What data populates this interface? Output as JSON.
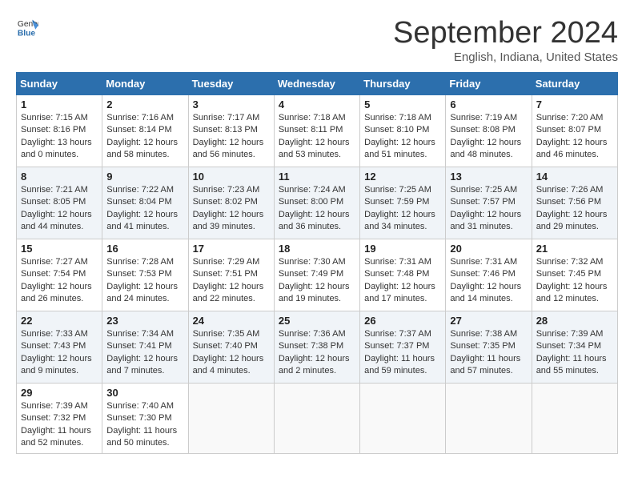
{
  "header": {
    "logo_general": "General",
    "logo_blue": "Blue",
    "month_title": "September 2024",
    "subtitle": "English, Indiana, United States"
  },
  "weekdays": [
    "Sunday",
    "Monday",
    "Tuesday",
    "Wednesday",
    "Thursday",
    "Friday",
    "Saturday"
  ],
  "weeks": [
    [
      {
        "day": "1",
        "info": "Sunrise: 7:15 AM\nSunset: 8:16 PM\nDaylight: 13 hours\nand 0 minutes."
      },
      {
        "day": "2",
        "info": "Sunrise: 7:16 AM\nSunset: 8:14 PM\nDaylight: 12 hours\nand 58 minutes."
      },
      {
        "day": "3",
        "info": "Sunrise: 7:17 AM\nSunset: 8:13 PM\nDaylight: 12 hours\nand 56 minutes."
      },
      {
        "day": "4",
        "info": "Sunrise: 7:18 AM\nSunset: 8:11 PM\nDaylight: 12 hours\nand 53 minutes."
      },
      {
        "day": "5",
        "info": "Sunrise: 7:18 AM\nSunset: 8:10 PM\nDaylight: 12 hours\nand 51 minutes."
      },
      {
        "day": "6",
        "info": "Sunrise: 7:19 AM\nSunset: 8:08 PM\nDaylight: 12 hours\nand 48 minutes."
      },
      {
        "day": "7",
        "info": "Sunrise: 7:20 AM\nSunset: 8:07 PM\nDaylight: 12 hours\nand 46 minutes."
      }
    ],
    [
      {
        "day": "8",
        "info": "Sunrise: 7:21 AM\nSunset: 8:05 PM\nDaylight: 12 hours\nand 44 minutes."
      },
      {
        "day": "9",
        "info": "Sunrise: 7:22 AM\nSunset: 8:04 PM\nDaylight: 12 hours\nand 41 minutes."
      },
      {
        "day": "10",
        "info": "Sunrise: 7:23 AM\nSunset: 8:02 PM\nDaylight: 12 hours\nand 39 minutes."
      },
      {
        "day": "11",
        "info": "Sunrise: 7:24 AM\nSunset: 8:00 PM\nDaylight: 12 hours\nand 36 minutes."
      },
      {
        "day": "12",
        "info": "Sunrise: 7:25 AM\nSunset: 7:59 PM\nDaylight: 12 hours\nand 34 minutes."
      },
      {
        "day": "13",
        "info": "Sunrise: 7:25 AM\nSunset: 7:57 PM\nDaylight: 12 hours\nand 31 minutes."
      },
      {
        "day": "14",
        "info": "Sunrise: 7:26 AM\nSunset: 7:56 PM\nDaylight: 12 hours\nand 29 minutes."
      }
    ],
    [
      {
        "day": "15",
        "info": "Sunrise: 7:27 AM\nSunset: 7:54 PM\nDaylight: 12 hours\nand 26 minutes."
      },
      {
        "day": "16",
        "info": "Sunrise: 7:28 AM\nSunset: 7:53 PM\nDaylight: 12 hours\nand 24 minutes."
      },
      {
        "day": "17",
        "info": "Sunrise: 7:29 AM\nSunset: 7:51 PM\nDaylight: 12 hours\nand 22 minutes."
      },
      {
        "day": "18",
        "info": "Sunrise: 7:30 AM\nSunset: 7:49 PM\nDaylight: 12 hours\nand 19 minutes."
      },
      {
        "day": "19",
        "info": "Sunrise: 7:31 AM\nSunset: 7:48 PM\nDaylight: 12 hours\nand 17 minutes."
      },
      {
        "day": "20",
        "info": "Sunrise: 7:31 AM\nSunset: 7:46 PM\nDaylight: 12 hours\nand 14 minutes."
      },
      {
        "day": "21",
        "info": "Sunrise: 7:32 AM\nSunset: 7:45 PM\nDaylight: 12 hours\nand 12 minutes."
      }
    ],
    [
      {
        "day": "22",
        "info": "Sunrise: 7:33 AM\nSunset: 7:43 PM\nDaylight: 12 hours\nand 9 minutes."
      },
      {
        "day": "23",
        "info": "Sunrise: 7:34 AM\nSunset: 7:41 PM\nDaylight: 12 hours\nand 7 minutes."
      },
      {
        "day": "24",
        "info": "Sunrise: 7:35 AM\nSunset: 7:40 PM\nDaylight: 12 hours\nand 4 minutes."
      },
      {
        "day": "25",
        "info": "Sunrise: 7:36 AM\nSunset: 7:38 PM\nDaylight: 12 hours\nand 2 minutes."
      },
      {
        "day": "26",
        "info": "Sunrise: 7:37 AM\nSunset: 7:37 PM\nDaylight: 11 hours\nand 59 minutes."
      },
      {
        "day": "27",
        "info": "Sunrise: 7:38 AM\nSunset: 7:35 PM\nDaylight: 11 hours\nand 57 minutes."
      },
      {
        "day": "28",
        "info": "Sunrise: 7:39 AM\nSunset: 7:34 PM\nDaylight: 11 hours\nand 55 minutes."
      }
    ],
    [
      {
        "day": "29",
        "info": "Sunrise: 7:39 AM\nSunset: 7:32 PM\nDaylight: 11 hours\nand 52 minutes."
      },
      {
        "day": "30",
        "info": "Sunrise: 7:40 AM\nSunset: 7:30 PM\nDaylight: 11 hours\nand 50 minutes."
      },
      {
        "day": "",
        "info": ""
      },
      {
        "day": "",
        "info": ""
      },
      {
        "day": "",
        "info": ""
      },
      {
        "day": "",
        "info": ""
      },
      {
        "day": "",
        "info": ""
      }
    ]
  ]
}
